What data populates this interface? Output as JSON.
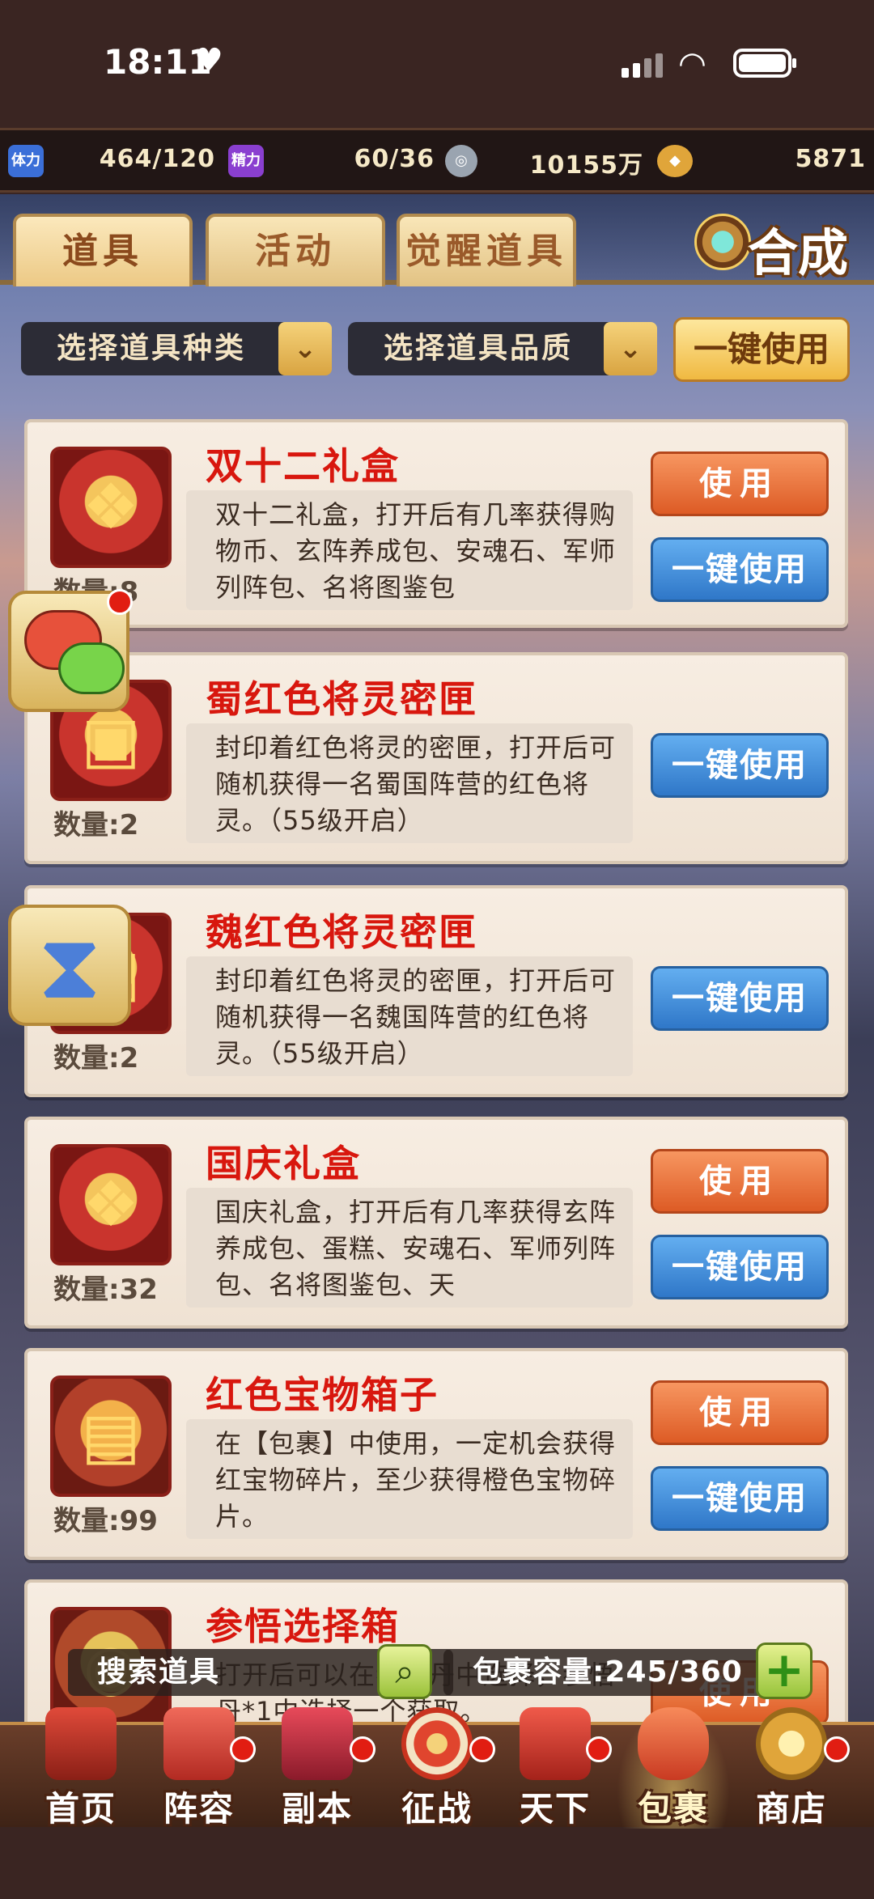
{
  "status_bar": {
    "time": "18:11"
  },
  "resources": [
    {
      "icon": "stamina-icon",
      "label": "体力",
      "value": "464/120",
      "color": "#3b6fd8"
    },
    {
      "icon": "energy-icon",
      "label": "精力",
      "value": "60/36",
      "color": "#8a3fd0"
    },
    {
      "icon": "coin-icon",
      "label": "",
      "value": "10155万",
      "color": "#9aa4b0"
    },
    {
      "icon": "gold-ingot-icon",
      "label": "",
      "value": "5871",
      "color": "#e0a53a"
    }
  ],
  "tabs": [
    {
      "label": "道具",
      "active": true
    },
    {
      "label": "活动",
      "active": false
    },
    {
      "label": "觉醒道具",
      "active": false
    }
  ],
  "synth_button": "合成",
  "filters": {
    "type_placeholder": "选择道具种类",
    "quality_placeholder": "选择道具品质",
    "arrow": "⌄",
    "use_all_button": "一键使用"
  },
  "items": [
    {
      "name": "双十二礼盒",
      "qty": "数量:8",
      "desc": "双十二礼盒，打开后有几率获得购物币、玄阵养成包、安魂石、军师列阵包、名将图鉴包",
      "use": "使用",
      "one_key": "一键使用",
      "has_use": true
    },
    {
      "name": "蜀红色将灵密匣",
      "qty": "数量:2",
      "desc": "封印着红色将灵的密匣，打开后可随机获得一名蜀国阵营的红色将灵。（55级开启）",
      "one_key": "一键使用",
      "has_use": false
    },
    {
      "name": "魏红色将灵密匣",
      "qty": "数量:2",
      "desc": "封印着红色将灵的密匣，打开后可随机获得一名魏国阵营的红色将灵。（55级开启）",
      "one_key": "一键使用",
      "has_use": false
    },
    {
      "name": "国庆礼盒",
      "qty": "数量:32",
      "desc": "国庆礼盒，打开后有几率获得玄阵养成包、蛋糕、安魂石、军师列阵包、名将图鉴包、天",
      "use": "使用",
      "one_key": "一键使用",
      "has_use": true
    },
    {
      "name": "红色宝物箱子",
      "qty": "数量:99",
      "desc": "在【包裹】中使用，一定机会获得红宝物碎片，至少获得橙色宝物碎片。",
      "use": "使用",
      "one_key": "一键使用",
      "has_use": true
    },
    {
      "name": "参悟选择箱",
      "qty": "",
      "desc": "打开后可以在参悟丹中选择，参悟丹*1中选择一个获取。",
      "use": "使用",
      "has_use": true
    }
  ],
  "bottom_bar": {
    "search_label": "搜索道具",
    "capacity_label": "包裹容量:245/360"
  },
  "nav": [
    {
      "label": "首页",
      "icon": "home-icon",
      "color": "#c93a2c"
    },
    {
      "label": "阵容",
      "icon": "lineup-icon",
      "color": "#d24a3c"
    },
    {
      "label": "副本",
      "icon": "dungeon-icon",
      "color": "#c2243a"
    },
    {
      "label": "征战",
      "icon": "battle-icon",
      "color": "#d8452e"
    },
    {
      "label": "天下",
      "icon": "world-icon",
      "color": "#cf3a30"
    },
    {
      "label": "包裹",
      "icon": "bag-icon",
      "color": "#e05a3b"
    },
    {
      "label": "商店",
      "icon": "shop-icon",
      "color": "#d9a53a"
    }
  ]
}
